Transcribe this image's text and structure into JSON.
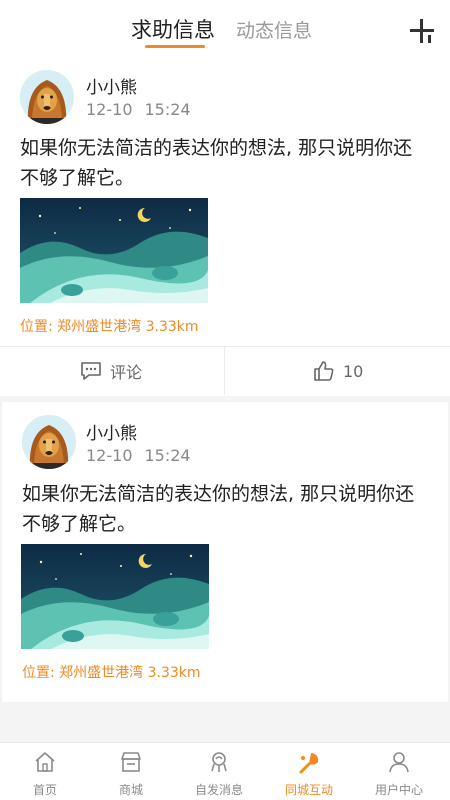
{
  "header": {
    "tabs": [
      {
        "label": "求助信息",
        "active": true
      },
      {
        "label": "动态信息",
        "active": false
      }
    ],
    "add_icon": "plus-icon"
  },
  "posts": [
    {
      "username": "小小熊",
      "date": "12-10",
      "time": "15:24",
      "content": "如果你无法简洁的表达你的想法, 那只说明你还不够了解它。",
      "location": "位置: 郑州盛世港湾 3.33km",
      "comment_label": "评论",
      "like_count": "10"
    },
    {
      "username": "小小熊",
      "date": "12-10",
      "time": "15:24",
      "content": "如果你无法简洁的表达你的想法, 那只说明你还不够了解它。",
      "location": "位置: 郑州盛世港湾 3.33km"
    }
  ],
  "bottom_nav": [
    {
      "label": "首页",
      "icon": "home-icon",
      "active": false
    },
    {
      "label": "商城",
      "icon": "store-icon",
      "active": false
    },
    {
      "label": "自发消息",
      "icon": "post-icon",
      "active": false
    },
    {
      "label": "同城互动",
      "icon": "interact-icon",
      "active": true
    },
    {
      "label": "用户中心",
      "icon": "user-icon",
      "active": false
    }
  ],
  "colors": {
    "accent": "#f08a24",
    "muted": "#8a8a8a",
    "text": "#222222"
  }
}
